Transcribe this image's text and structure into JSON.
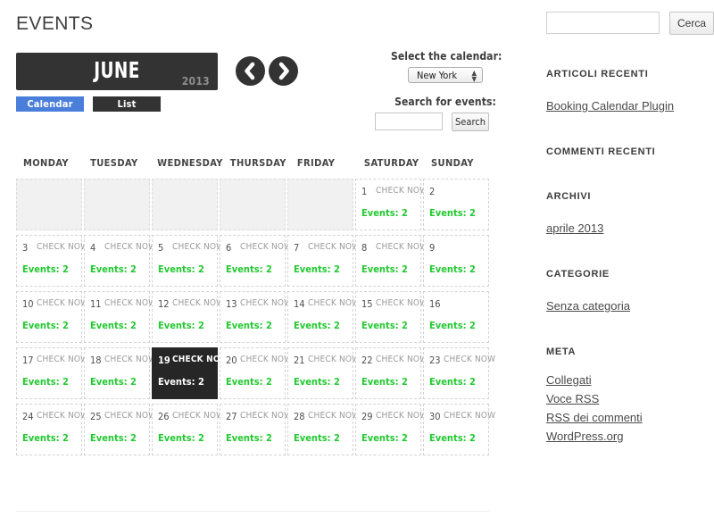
{
  "page": {
    "title": "EVENTS"
  },
  "calendar": {
    "month": "JUNE",
    "year": "2013",
    "nav": {
      "prev_name": "previous-month",
      "next_name": "next-month"
    },
    "tabs": [
      {
        "label": "Calendar",
        "active": true
      },
      {
        "label": "List",
        "active": false
      }
    ],
    "controls": {
      "select_calendar_label": "Select the calendar:",
      "selected_calendar": "New York",
      "calendar_options": [
        "New York"
      ],
      "search_events_label": "Search for events:",
      "search_value": "",
      "search_placeholder": "",
      "search_button": "Search"
    },
    "day_headers": [
      "MONDAY",
      "TUESDAY",
      "WEDNESDAY",
      "THURSDAY",
      "FRIDAY",
      "SATURDAY",
      "SUNDAY"
    ],
    "check_now_label": "CHECK NOW",
    "weeks": [
      [
        {
          "empty": true
        },
        {
          "empty": true
        },
        {
          "empty": true
        },
        {
          "empty": true
        },
        {
          "empty": true
        },
        {
          "day": "1",
          "check": true,
          "events": "Events: 2",
          "highlight": false
        },
        {
          "day": "2",
          "check": false,
          "events": "Events: 2",
          "highlight": false
        }
      ],
      [
        {
          "day": "3",
          "check": true,
          "events": "Events: 2",
          "highlight": false
        },
        {
          "day": "4",
          "check": true,
          "events": "Events: 2",
          "highlight": false
        },
        {
          "day": "5",
          "check": true,
          "events": "Events: 2",
          "highlight": false
        },
        {
          "day": "6",
          "check": true,
          "events": "Events: 2",
          "highlight": false
        },
        {
          "day": "7",
          "check": true,
          "events": "Events: 2",
          "highlight": false
        },
        {
          "day": "8",
          "check": true,
          "events": "Events: 2",
          "highlight": false
        },
        {
          "day": "9",
          "check": false,
          "events": "Events: 2",
          "highlight": false
        }
      ],
      [
        {
          "day": "10",
          "check": true,
          "events": "Events: 2",
          "highlight": false
        },
        {
          "day": "11",
          "check": true,
          "events": "Events: 2",
          "highlight": false
        },
        {
          "day": "12",
          "check": true,
          "events": "Events: 2",
          "highlight": false
        },
        {
          "day": "13",
          "check": true,
          "events": "Events: 2",
          "highlight": false
        },
        {
          "day": "14",
          "check": true,
          "events": "Events: 2",
          "highlight": false
        },
        {
          "day": "15",
          "check": true,
          "events": "Events: 2",
          "highlight": false
        },
        {
          "day": "16",
          "check": false,
          "events": "Events: 2",
          "highlight": false
        }
      ],
      [
        {
          "day": "17",
          "check": true,
          "events": "Events: 2",
          "highlight": false
        },
        {
          "day": "18",
          "check": true,
          "events": "Events: 2",
          "highlight": false
        },
        {
          "day": "19",
          "check": true,
          "events": "Events: 2",
          "highlight": true
        },
        {
          "day": "20",
          "check": true,
          "events": "Events: 2",
          "highlight": false
        },
        {
          "day": "21",
          "check": true,
          "events": "Events: 2",
          "highlight": false
        },
        {
          "day": "22",
          "check": true,
          "events": "Events: 2",
          "highlight": false
        },
        {
          "day": "23",
          "check": true,
          "events": "Events: 2",
          "highlight": false
        }
      ],
      [
        {
          "day": "24",
          "check": true,
          "events": "Events: 2",
          "highlight": false
        },
        {
          "day": "25",
          "check": true,
          "events": "Events: 2",
          "highlight": false
        },
        {
          "day": "26",
          "check": true,
          "events": "Events: 2",
          "highlight": false
        },
        {
          "day": "27",
          "check": true,
          "events": "Events: 2",
          "highlight": false
        },
        {
          "day": "28",
          "check": true,
          "events": "Events: 2",
          "highlight": false
        },
        {
          "day": "29",
          "check": true,
          "events": "Events: 2",
          "highlight": false
        },
        {
          "day": "30",
          "check": true,
          "events": "Events: 2",
          "highlight": false
        }
      ]
    ]
  },
  "sidebar": {
    "search": {
      "value": "",
      "placeholder": "",
      "button": "Cerca"
    },
    "sections": [
      {
        "title": "ARTICOLI RECENTI",
        "links": [
          "Booking Calendar Plugin"
        ]
      },
      {
        "title": "COMMENTI RECENTI",
        "links": []
      },
      {
        "title": "ARCHIVI",
        "links": [
          "aprile 2013"
        ]
      },
      {
        "title": "CATEGORIE",
        "links": [
          "Senza categoria"
        ]
      },
      {
        "title": "META",
        "links": [
          "Collegati",
          "Voce RSS",
          "RSS dei commenti",
          "WordPress.org"
        ]
      }
    ]
  },
  "colors": {
    "accent_blue": "#4a7edb",
    "dark": "#333333",
    "event_green": "#22c930",
    "highlight_bg": "#262626"
  }
}
